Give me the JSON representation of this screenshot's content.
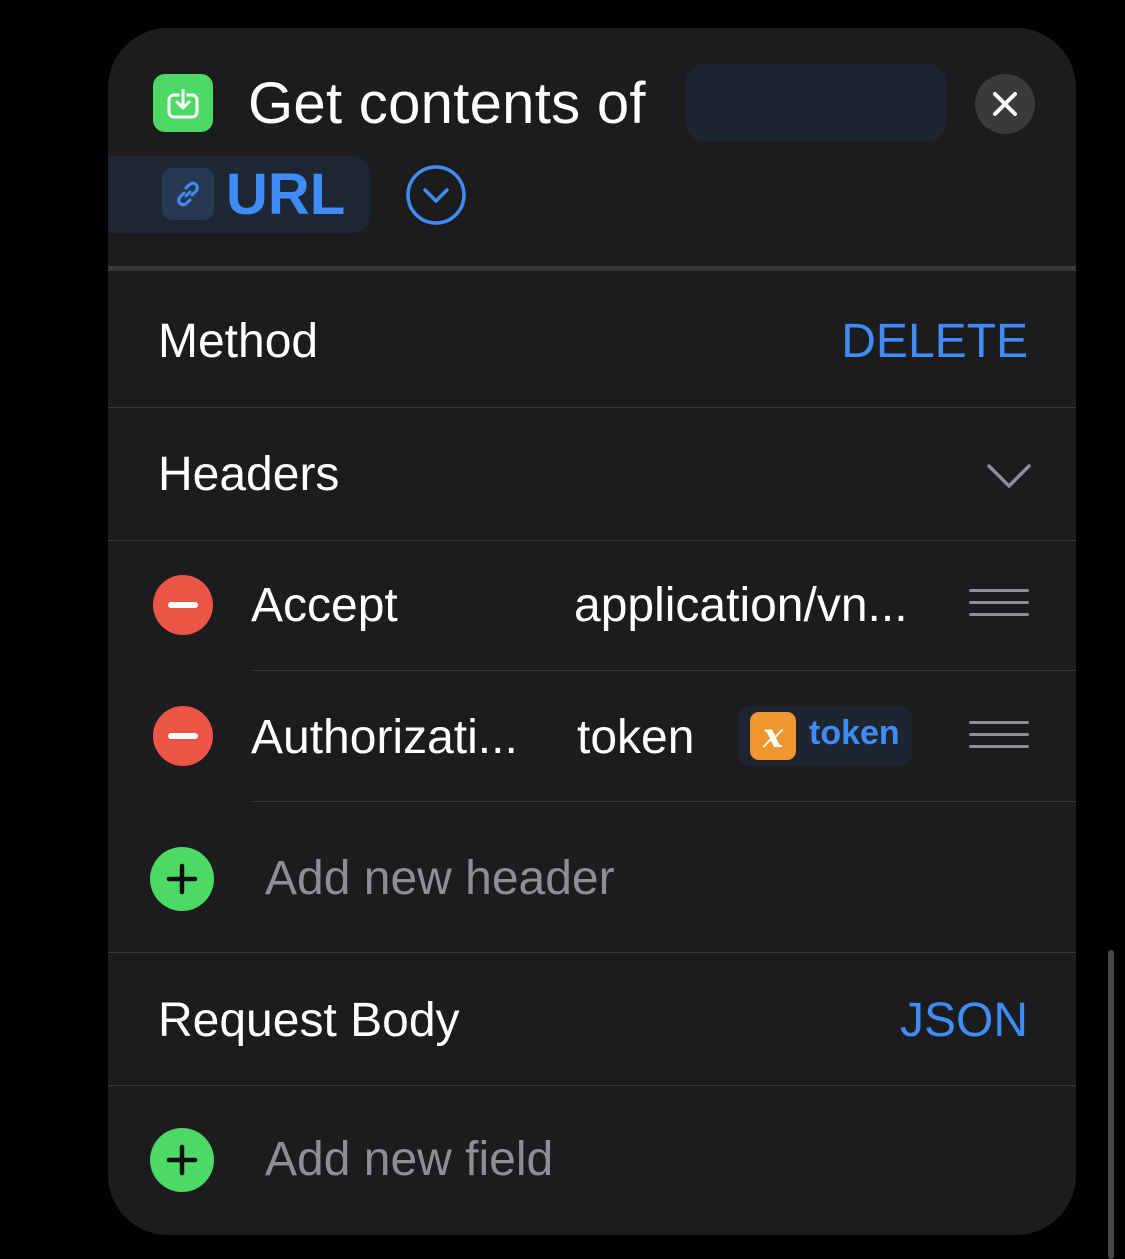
{
  "action": {
    "title": "Get contents of",
    "url_token_label": "URL",
    "icon": "download-into-tray-icon"
  },
  "rows": {
    "method": {
      "label": "Method",
      "value": "DELETE"
    },
    "headers": {
      "label": "Headers",
      "items": [
        {
          "key": "Accept",
          "value": "application/vn..."
        },
        {
          "key": "Authorizati...",
          "value_text": "token",
          "variable": "token"
        }
      ],
      "add_placeholder": "Add new header"
    },
    "request_body": {
      "label": "Request Body",
      "value": "JSON",
      "add_placeholder": "Add new field"
    }
  },
  "colors": {
    "background": "#000000",
    "card": "#1c1c1e",
    "accent_blue": "#3f8cf7",
    "add_green": "#4cd964",
    "remove_red": "#eb5545",
    "variable_orange": "#f0962e",
    "secondary_text": "#8e8e93"
  }
}
